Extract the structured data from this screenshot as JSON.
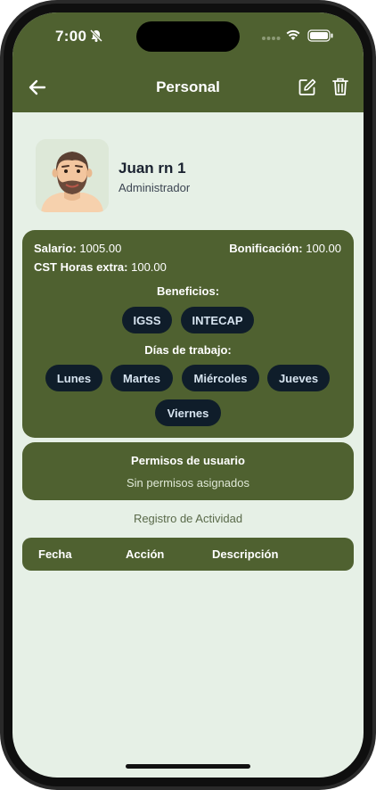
{
  "status_bar": {
    "time": "7:00"
  },
  "header": {
    "title": "Personal"
  },
  "profile": {
    "name": "Juan rn 1",
    "role": "Administrador"
  },
  "details": {
    "salary_label": "Salario:",
    "salary_value": "1005.00",
    "bonus_label": "Bonificación:",
    "bonus_value": "100.00",
    "overtime_label": "CST Horas extra:",
    "overtime_value": "100.00",
    "benefits_label": "Beneficios:",
    "benefits": [
      "IGSS",
      "INTECAP"
    ],
    "workdays_label": "Días de trabajo:",
    "workdays": [
      "Lunes",
      "Martes",
      "Miércoles",
      "Jueves",
      "Viernes"
    ]
  },
  "permissions": {
    "title": "Permisos de usuario",
    "empty_text": "Sin permisos asignados"
  },
  "activity": {
    "title": "Registro de Actividad",
    "columns": [
      "Fecha",
      "Acción",
      "Descripción"
    ]
  },
  "colors": {
    "primary": "#4f6130",
    "background": "#e6f0e6",
    "chip": "#0f1d2a"
  }
}
